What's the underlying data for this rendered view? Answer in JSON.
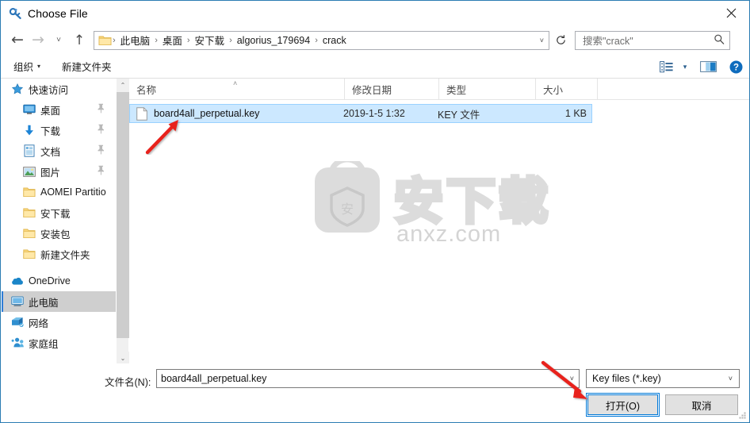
{
  "window": {
    "title": "Choose File",
    "icon": "key-icon",
    "close_label": "✕"
  },
  "nav": {
    "back": "←",
    "forward": "→",
    "history_dropdown": "˅",
    "up": "↑",
    "refresh": "↻",
    "address_dropdown": "˅",
    "breadcrumb": [
      "此电脑",
      "桌面",
      "安下载",
      "algorius_179694",
      "crack"
    ],
    "breadcrumb_separator": "›"
  },
  "search": {
    "placeholder": "搜索\"crack\"",
    "icon": "search-icon"
  },
  "command_bar": {
    "organize_label": "组织",
    "organize_caret": "▾",
    "new_folder_label": "新建文件夹",
    "view_icon": "list-view-icon",
    "view_caret": "▾",
    "preview_icon": "preview-pane-icon",
    "help_icon": "help-icon"
  },
  "sidebar": {
    "items": [
      {
        "label": "快速访问",
        "icon": "star-pin-icon",
        "indent": 0,
        "pinned": false,
        "selected": false
      },
      {
        "label": "桌面",
        "icon": "desktop-icon",
        "indent": 1,
        "pinned": true,
        "selected": false
      },
      {
        "label": "下载",
        "icon": "download-icon",
        "indent": 1,
        "pinned": true,
        "selected": false
      },
      {
        "label": "文档",
        "icon": "documents-icon",
        "indent": 1,
        "pinned": true,
        "selected": false
      },
      {
        "label": "图片",
        "icon": "pictures-icon",
        "indent": 1,
        "pinned": true,
        "selected": false
      },
      {
        "label": "AOMEI Partitio",
        "icon": "folder-icon",
        "indent": 1,
        "pinned": false,
        "selected": false
      },
      {
        "label": "安下载",
        "icon": "folder-icon",
        "indent": 1,
        "pinned": false,
        "selected": false
      },
      {
        "label": "安装包",
        "icon": "folder-icon",
        "indent": 1,
        "pinned": false,
        "selected": false
      },
      {
        "label": "新建文件夹",
        "icon": "folder-icon",
        "indent": 1,
        "pinned": false,
        "selected": false
      },
      {
        "label": "OneDrive",
        "icon": "onedrive-icon",
        "indent": 0,
        "pinned": false,
        "selected": false
      },
      {
        "label": "此电脑",
        "icon": "thispc-icon",
        "indent": 0,
        "pinned": false,
        "selected": true
      },
      {
        "label": "网络",
        "icon": "network-icon",
        "indent": 0,
        "pinned": false,
        "selected": false
      },
      {
        "label": "家庭组",
        "icon": "homegroup-icon",
        "indent": 0,
        "pinned": false,
        "selected": false
      }
    ],
    "scroll_up": "⌃",
    "scroll_down": "⌄"
  },
  "file_list": {
    "columns": [
      {
        "label": "名称",
        "key": "name"
      },
      {
        "label": "修改日期",
        "key": "modified"
      },
      {
        "label": "类型",
        "key": "type"
      },
      {
        "label": "大小",
        "key": "size"
      }
    ],
    "sort_indicator": "˄",
    "rows": [
      {
        "name": "board4all_perpetual.key",
        "modified": "2019-1-5 1:32",
        "type": "KEY 文件",
        "size": "1 KB",
        "icon": "file-icon",
        "selected": true
      }
    ]
  },
  "watermark": {
    "text": "安下载",
    "subtext": "anxz.com",
    "badge_text": "安"
  },
  "footer": {
    "filename_label": "文件名(N):",
    "filename_value": "board4all_perpetual.key",
    "filename_dropdown": "˅",
    "filter_value": "Key files (*.key)",
    "filter_dropdown": "˅",
    "open_label": "打开(O)",
    "cancel_label": "取消"
  },
  "colors": {
    "accent": "#0078d7",
    "selection_bg": "#cce8ff",
    "selection_border": "#99d1ff",
    "sidebar_selected_bg": "#cfcfcf",
    "annotation_red": "#e8221b",
    "window_border": "#2b7cb3",
    "button_face": "#e1e1e1"
  }
}
